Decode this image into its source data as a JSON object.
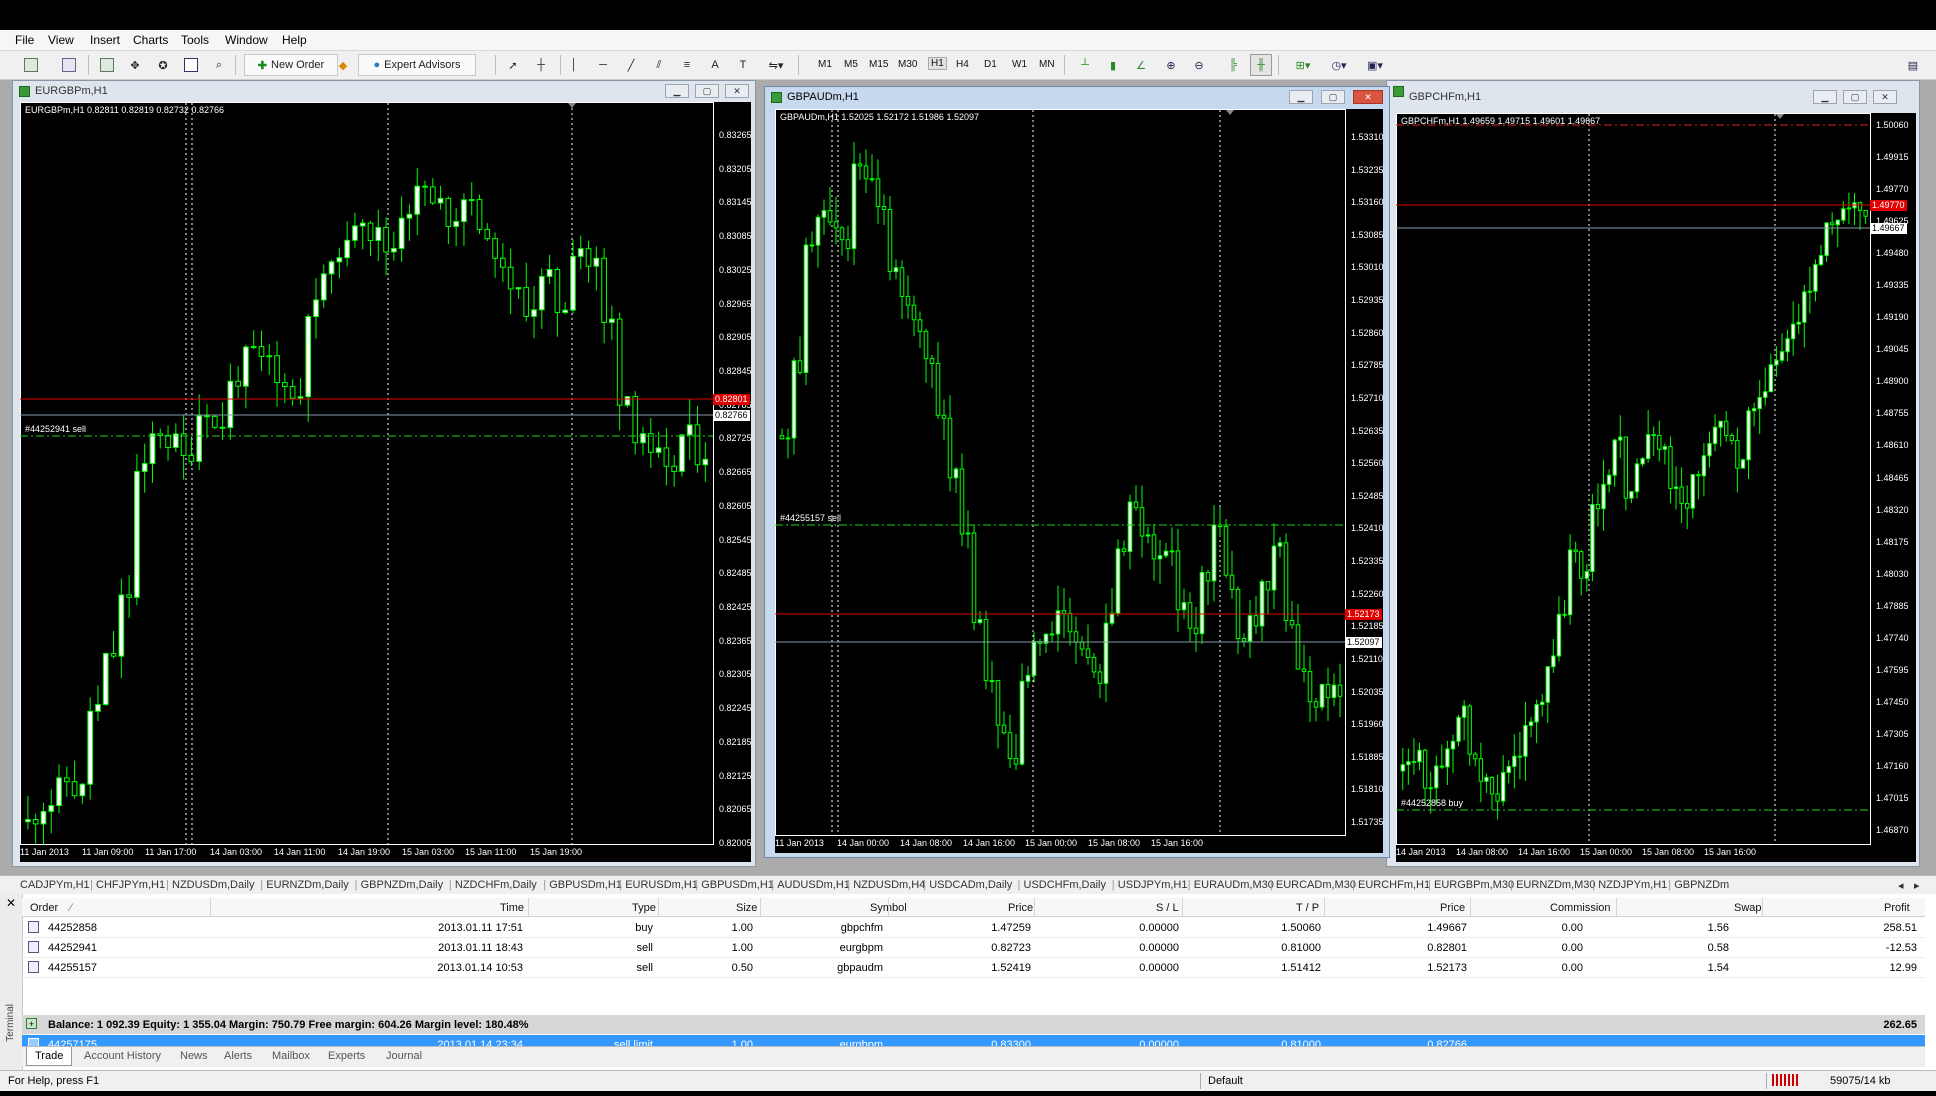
{
  "menu": [
    "File",
    "View",
    "Insert",
    "Charts",
    "Tools",
    "Window",
    "Help"
  ],
  "toolbar": {
    "new_order": "New Order",
    "expert_advisors": "Expert Advisors",
    "timeframes": [
      "M1",
      "M5",
      "M15",
      "M30",
      "H1",
      "H4",
      "D1",
      "W1",
      "MN"
    ]
  },
  "charts": [
    {
      "title": "EURGBPm,H1",
      "info": "EURGBPm,H1  0.82811 0.82819 0.82732 0.82766",
      "order_label": "#44252941 sell",
      "y_ticks": [
        "0.83265",
        "0.83205",
        "0.83145",
        "0.83085",
        "0.83025",
        "0.82965",
        "0.82905",
        "0.82845",
        "0.82785",
        "0.82725",
        "0.82665",
        "0.82605",
        "0.82545",
        "0.82485",
        "0.82425",
        "0.82365",
        "0.82305",
        "0.82245",
        "0.82185",
        "0.82125",
        "0.82065",
        "0.82005"
      ],
      "x_ticks": [
        "11 Jan 2013",
        "11 Jan 09:00",
        "11 Jan 17:00",
        "14 Jan 03:00",
        "14 Jan 11:00",
        "14 Jan 19:00",
        "15 Jan 03:00",
        "15 Jan 11:00",
        "15 Jan 19:00"
      ],
      "ask_box": "0.82801",
      "bid_box": "0.82766",
      "colors": {
        "ask": "#e00000",
        "bid": "#ffffff"
      }
    },
    {
      "title": "GBPAUDm,H1",
      "info": "GBPAUDm,H1  1.52025 1.52172 1.51986 1.52097",
      "order_label": "#44255157 sell",
      "y_ticks": [
        "1.53310",
        "1.53235",
        "1.53160",
        "1.53085",
        "1.53010",
        "1.52935",
        "1.52860",
        "1.52785",
        "1.52710",
        "1.52635",
        "1.52560",
        "1.52485",
        "1.52410",
        "1.52335",
        "1.52260",
        "1.52185",
        "1.52110",
        "1.52035",
        "1.51960",
        "1.51885",
        "1.51810",
        "1.51735"
      ],
      "x_ticks": [
        "11 Jan 2013",
        "14 Jan 00:00",
        "14 Jan 08:00",
        "14 Jan 16:00",
        "15 Jan 00:00",
        "15 Jan 08:00",
        "15 Jan 16:00"
      ],
      "ask_box": "1.52173",
      "bid_box": "1.52097",
      "colors": {
        "ask": "#e00000",
        "bid": "#ffffff"
      }
    },
    {
      "title": "GBPCHFm,H1",
      "info": "GBPCHFm,H1  1.49659 1.49715 1.49601 1.49667",
      "order_label": "#44252858 buy",
      "y_ticks": [
        "1.50060",
        "1.49915",
        "1.49770",
        "1.49625",
        "1.49480",
        "1.49335",
        "1.49190",
        "1.49045",
        "1.48900",
        "1.48755",
        "1.48610",
        "1.48465",
        "1.48320",
        "1.48175",
        "1.48030",
        "1.47885",
        "1.47740",
        "1.47595",
        "1.47450",
        "1.47305",
        "1.47160",
        "1.47015",
        "1.46870"
      ],
      "x_ticks": [
        "14 Jan 2013",
        "14 Jan 08:00",
        "14 Jan 16:00",
        "15 Jan 00:00",
        "15 Jan 08:00",
        "15 Jan 16:00"
      ],
      "ask_box": "1.49770",
      "bid_box": "1.49667",
      "colors": {
        "ask": "#e00000",
        "bid": "#ffffff"
      }
    }
  ],
  "symbol_tabs": [
    "CADJPYm,H1",
    "CHFJPYm,H1",
    "NZDUSDm,Daily",
    "EURNZDm,Daily",
    "GBPNZDm,Daily",
    "NZDCHFm,Daily",
    "GBPUSDm,H1",
    "EURUSDm,H1",
    "GBPUSDm,H1",
    "AUDUSDm,H1",
    "NZDUSDm,H4",
    "USDCADm,Daily",
    "USDCHFm,Daily",
    "USDJPYm,H1",
    "EURAUDm,M30",
    "EURCADm,M30",
    "EURCHFm,H1",
    "EURGBPm,M30",
    "EURNZDm,M30",
    "NZDJPYm,H1",
    "GBPNZDm"
  ],
  "terminal": {
    "headers": [
      "Order",
      "Time",
      "Type",
      "Size",
      "Symbol",
      "Price",
      "S / L",
      "T / P",
      "Price",
      "Commission",
      "Swap",
      "Profit"
    ],
    "rows": [
      [
        "44252858",
        "2013.01.11 17:51",
        "buy",
        "1.00",
        "gbpchfm",
        "1.47259",
        "0.00000",
        "1.50060",
        "1.49667",
        "0.00",
        "1.56",
        "258.51"
      ],
      [
        "44252941",
        "2013.01.11 18:43",
        "sell",
        "1.00",
        "eurgbpm",
        "0.82723",
        "0.00000",
        "0.81000",
        "0.82801",
        "0.00",
        "0.58",
        "-12.53"
      ],
      [
        "44255157",
        "2013.01.14 10:53",
        "sell",
        "0.50",
        "gbpaudm",
        "1.52419",
        "0.00000",
        "1.51412",
        "1.52173",
        "0.00",
        "1.54",
        "12.99"
      ]
    ],
    "balance": "Balance: 1 092.39  Equity: 1 355.04  Margin: 750.79  Free margin: 604.26  Margin level: 180.48%",
    "balance_profit": "262.65",
    "pending": [
      "44257175",
      "2013.01.14 23:34",
      "sell limit",
      "1.00",
      "eurgbpm",
      "0.83300",
      "0.00000",
      "0.81000",
      "0.82766"
    ],
    "tabs": [
      "Trade",
      "Account History",
      "News",
      "Alerts",
      "Mailbox",
      "Experts",
      "Journal"
    ],
    "side_label": "Terminal"
  },
  "status": {
    "help": "For Help, press F1",
    "profile": "Default",
    "traffic": "59075/14 kb"
  }
}
